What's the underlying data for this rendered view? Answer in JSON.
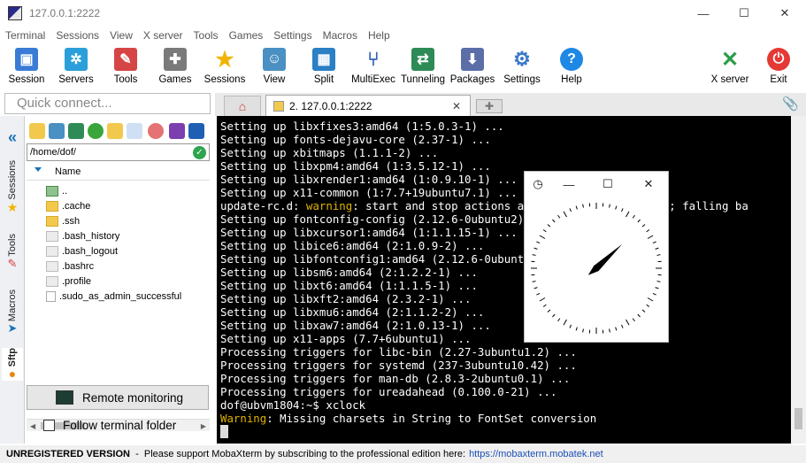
{
  "window": {
    "title": "127.0.0.1:2222",
    "minimize": "—",
    "maximize": "☐",
    "close": "✕"
  },
  "menu": [
    "Terminal",
    "Sessions",
    "View",
    "X server",
    "Tools",
    "Games",
    "Settings",
    "Macros",
    "Help"
  ],
  "toolbar": [
    {
      "label": "Session",
      "icon": "session-icon",
      "color": "#3a7bd5"
    },
    {
      "label": "Servers",
      "icon": "servers-icon",
      "color": "#2b9fd9"
    },
    {
      "label": "Tools",
      "icon": "tools-icon",
      "color": "#d64545"
    },
    {
      "label": "Games",
      "icon": "games-icon",
      "color": "#7a7a7a"
    },
    {
      "label": "Sessions",
      "icon": "star-icon",
      "color": "#f0b400"
    },
    {
      "label": "View",
      "icon": "view-icon",
      "color": "#4a90c2"
    },
    {
      "label": "Split",
      "icon": "split-icon",
      "color": "#2b7fc5"
    },
    {
      "label": "MultiExec",
      "icon": "multiexec-icon",
      "color": "#3565b5"
    },
    {
      "label": "Tunneling",
      "icon": "tunneling-icon",
      "color": "#2e8b57"
    },
    {
      "label": "Packages",
      "icon": "packages-icon",
      "color": "#5b6ea8"
    },
    {
      "label": "Settings",
      "icon": "gear-icon",
      "color": "#3b78c8"
    },
    {
      "label": "Help",
      "icon": "help-icon",
      "color": "#1e88e5"
    },
    {
      "label": "X server",
      "icon": "xserver-icon",
      "color": "#2a9d4a"
    },
    {
      "label": "Exit",
      "icon": "power-icon",
      "color": "#e53935"
    }
  ],
  "quick_connect": {
    "placeholder": "Quick connect..."
  },
  "tabs": {
    "active_label": "2. 127.0.0.1:2222",
    "close": "✕"
  },
  "side_tabs": [
    "Sessions",
    "Tools",
    "Macros",
    "Sftp"
  ],
  "sftp": {
    "path": "/home/dof/",
    "column_name": "Name",
    "files": [
      {
        "name": "..",
        "type": "up"
      },
      {
        "name": ".cache",
        "type": "folder"
      },
      {
        "name": ".ssh",
        "type": "folder"
      },
      {
        "name": ".bash_history",
        "type": "file"
      },
      {
        "name": ".bash_logout",
        "type": "file"
      },
      {
        "name": ".bashrc",
        "type": "file"
      },
      {
        "name": ".profile",
        "type": "file"
      },
      {
        "name": ".sudo_as_admin_successful",
        "type": "doc"
      }
    ],
    "remote_monitoring": "Remote monitoring",
    "follow_terminal": "Follow terminal folder"
  },
  "terminal": {
    "lines": [
      {
        "text": "Setting up libxfixes3:amd64 (1:5.0.3-1) ..."
      },
      {
        "text": "Setting up fonts-dejavu-core (2.37-1) ..."
      },
      {
        "text": "Setting up xbitmaps (1.1.1-2) ..."
      },
      {
        "text": "Setting up libxpm4:amd64 (1:3.5.12-1) ..."
      },
      {
        "text": "Setting up libxrender1:amd64 (1:0.9.10-1) ..."
      },
      {
        "text": "Setting up x11-common (1:7.7+19ubuntu7.1) ..."
      },
      {
        "prefix": "update-rc.d: ",
        "warn": "warning",
        "text": ": start and stop actions are no longer supported; falling ba"
      },
      {
        "text": "Setting up fontconfig-config (2.12.6-0ubuntu2) ..."
      },
      {
        "text": "Setting up libxcursor1:amd64 (1:1.1.15-1) ..."
      },
      {
        "text": "Setting up libice6:amd64 (2:1.0.9-2) ..."
      },
      {
        "text": "Setting up libfontconfig1:amd64 (2.12.6-0ubuntu2) ..."
      },
      {
        "text": "Setting up libsm6:amd64 (2:1.2.2-1) ..."
      },
      {
        "text": "Setting up libxt6:amd64 (1:1.1.5-1) ..."
      },
      {
        "text": "Setting up libxft2:amd64 (2.3.2-1) ..."
      },
      {
        "text": "Setting up libxmu6:amd64 (2:1.1.2-2) ..."
      },
      {
        "text": "Setting up libxaw7:amd64 (2:1.0.13-1) ..."
      },
      {
        "text": "Setting up x11-apps (7.7+6ubuntu1) ..."
      },
      {
        "text": "Processing triggers for libc-bin (2.27-3ubuntu1.2) ..."
      },
      {
        "text": "Processing triggers for systemd (237-3ubuntu10.42) ..."
      },
      {
        "text": "Processing triggers for man-db (2.8.3-2ubuntu0.1) ..."
      },
      {
        "text": "Processing triggers for ureadahead (0.100.0-21) ..."
      },
      {
        "text": "dof@ubvm1804:~$ xclock"
      },
      {
        "prefix": "",
        "warn": "Warning",
        "text": ": Missing charsets in String to FontSet conversion"
      }
    ]
  },
  "xclock": {
    "minimize": "—",
    "maximize": "☐",
    "close": "✕",
    "hour_hand_deg": 47,
    "minute_hand_deg": 230
  },
  "status": {
    "bold": "UNREGISTERED VERSION",
    "text": "  -  Please support MobaXterm by subscribing to the professional edition here:",
    "link": "https://mobaxterm.mobatek.net"
  }
}
